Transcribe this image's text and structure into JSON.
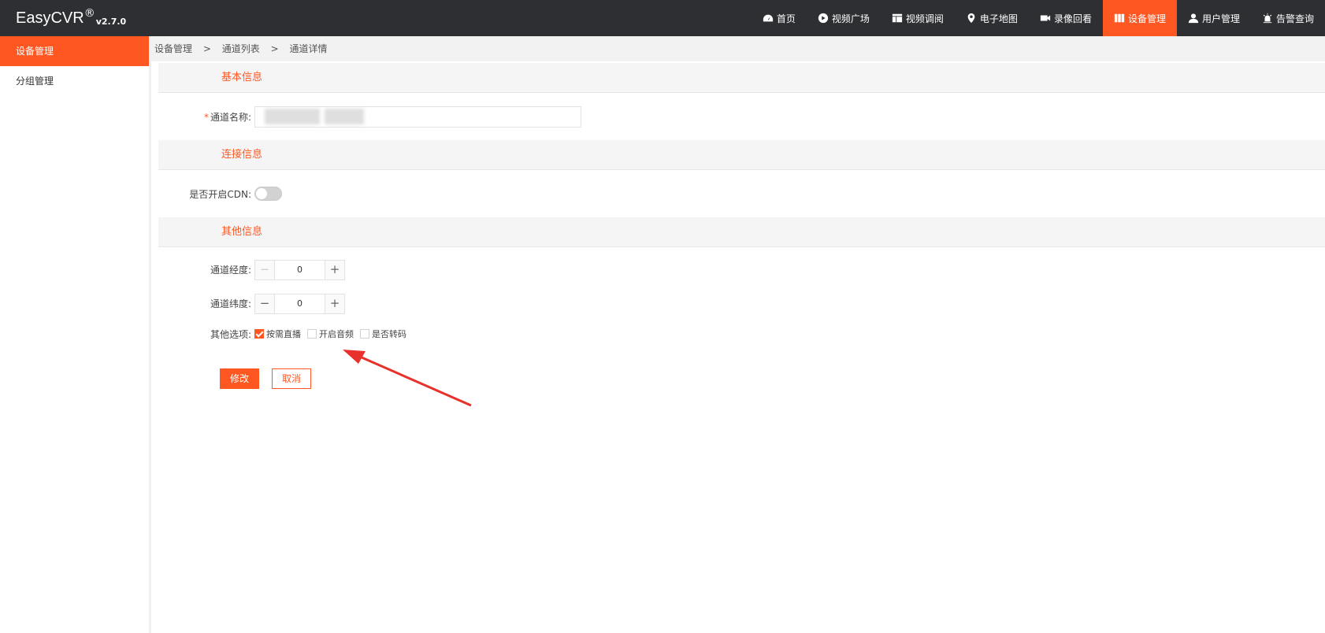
{
  "app": {
    "name": "EasyCVR",
    "reg": "®",
    "version": "v2.7.0"
  },
  "nav": [
    {
      "label": "首页",
      "icon": "dashboard-icon"
    },
    {
      "label": "视频广场",
      "icon": "play-circle-icon"
    },
    {
      "label": "视频调阅",
      "icon": "layout-icon"
    },
    {
      "label": "电子地图",
      "icon": "map-pin-icon"
    },
    {
      "label": "录像回看",
      "icon": "video-camera-icon"
    },
    {
      "label": "设备管理",
      "icon": "device-grid-icon",
      "active": true
    },
    {
      "label": "用户管理",
      "icon": "user-icon"
    },
    {
      "label": "告警查询",
      "icon": "alarm-icon"
    }
  ],
  "sidebar": {
    "items": [
      {
        "label": "设备管理",
        "active": true
      },
      {
        "label": "分组管理"
      }
    ]
  },
  "breadcrumb": {
    "items": [
      "设备管理",
      "通道列表",
      "通道详情"
    ],
    "sep": ">"
  },
  "sections": {
    "basic": {
      "title": "基本信息"
    },
    "connect": {
      "title": "连接信息"
    },
    "other": {
      "title": "其他信息"
    }
  },
  "form": {
    "required_mark": "*",
    "channel_name": {
      "label": "通道名称:"
    },
    "cdn": {
      "label": "是否开启CDN:",
      "on": false
    },
    "longitude": {
      "label": "通道经度:",
      "value": "0"
    },
    "latitude": {
      "label": "通道纬度:",
      "value": "0"
    },
    "options": {
      "label": "其他选项:",
      "items": [
        {
          "label": "按需直播",
          "checked": true
        },
        {
          "label": "开启音频",
          "checked": false
        },
        {
          "label": "是否转码",
          "checked": false
        }
      ]
    },
    "stepper": {
      "minus": "−",
      "plus": "+"
    }
  },
  "buttons": {
    "submit": "修改",
    "cancel": "取消"
  },
  "colors": {
    "accent": "#ff5722",
    "topbar": "#2d2f33",
    "arrow": "#e8312a"
  }
}
